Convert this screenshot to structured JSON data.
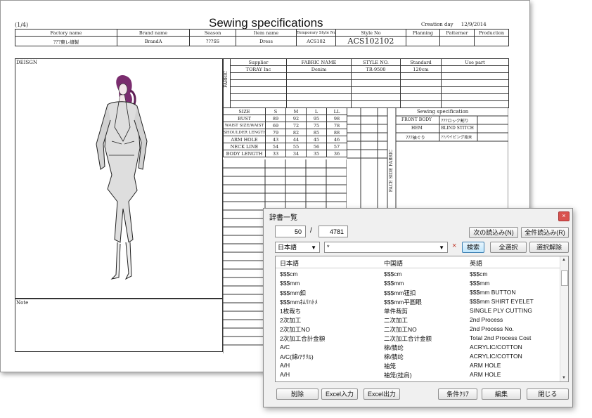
{
  "sheet": {
    "page": "(1/4)",
    "title": "Sewing specifications",
    "creation_label": "Creation day",
    "creation_date": "12/9/2014",
    "header_labels": [
      "Factory name",
      "Brand name",
      "Season",
      "Item name",
      "Temporary Style No",
      "Style No",
      "Planning",
      "Patterner",
      "Production"
    ],
    "header_values": [
      "???東レ縫製",
      "BrandA",
      "???SS",
      "Dress",
      "ACS102",
      "ACS102102"
    ],
    "design_label": "DEISGN",
    "note_label": "Note",
    "fabric_label": "FABRIC",
    "fabric_headers": [
      "Supplier",
      "FABRIC NAME",
      "STYLE NO.",
      "Standard",
      "Use part"
    ],
    "fabric_row": [
      "TORAY Inc",
      "Denim",
      "TR-9500",
      "120cm",
      ""
    ],
    "size_headers": [
      "SIZE",
      "S",
      "M",
      "L",
      "LL"
    ],
    "size_rows": [
      [
        "BUST",
        "89",
        "92",
        "95",
        "98"
      ],
      [
        "WAIST SIZE/WAIST",
        "69",
        "72",
        "75",
        "78"
      ],
      [
        "SHOULDER LENGTH",
        "79",
        "82",
        "85",
        "88"
      ],
      [
        "ARM HOLE",
        "43",
        "44",
        "45",
        "46"
      ],
      [
        "NECK LINE",
        "54",
        "55",
        "56",
        "57"
      ],
      [
        "BODY LENGTH",
        "33",
        "34",
        "35",
        "36"
      ]
    ],
    "sewing_spec_label": "Sewing specification",
    "sewing_rows": [
      [
        "FRONT BODY",
        "???ロック割り"
      ],
      [
        "HEM",
        "BLIND STITCH"
      ],
      [
        "???袖ぐり",
        "??パイピング始末"
      ]
    ],
    "face_side_fabric_label": "FACE SIDE FABRIC"
  },
  "dialog": {
    "title": "辞書一覧",
    "close_icon": "×",
    "current": "50",
    "separator": "/",
    "total": "4781",
    "next_load": "次の読込み(N)",
    "load_all": "全件読込み(R)",
    "language": "日本語",
    "search_value": "*",
    "clear_icon": "×",
    "search_button": "検索",
    "select_all": "全選択",
    "deselect": "選択解除",
    "columns": [
      "日本語",
      "中国語",
      "英語"
    ],
    "rows": [
      [
        "$$$cm",
        "$$$cm",
        "$$$cm"
      ],
      [
        "$$$mm",
        "$$$mm",
        "$$$mm"
      ],
      [
        "$$$mm釦",
        "$$$mm钮扣",
        "$$$mm BUTTON"
      ],
      [
        "$$$mmﾈﾑﾘﾊﾄﾒ",
        "$$$mm平圆眼",
        "$$$mm SHIRT EYELET"
      ],
      [
        "1枚裁ち",
        "单件裁剪",
        "SINGLE PLY CUTTING"
      ],
      [
        "2次加工",
        "二次加工",
        "2nd Process"
      ],
      [
        "2次加工NO",
        "二次加工NO",
        "2nd Process No."
      ],
      [
        "2次加工合計金額",
        "二次加工合计金额",
        "Total 2nd Process Cost"
      ],
      [
        "A/C",
        "棉/腈纶",
        "ACRYLIC/COTTON"
      ],
      [
        "A/C(綿/ｱｸﾘﾙ)",
        "棉/腈纶",
        "ACRYLIC/COTTON"
      ],
      [
        "A/H",
        "袖笼",
        "ARM HOLE"
      ],
      [
        "A/H",
        "袖笼(挂肩)",
        "ARM HOLE"
      ]
    ],
    "buttons": {
      "delete": "削除",
      "excel_in": "Excel入力",
      "excel_out": "Excel出力",
      "clear_cond": "条件ｸﾘｱ",
      "edit": "編集",
      "close": "閉じる"
    }
  }
}
